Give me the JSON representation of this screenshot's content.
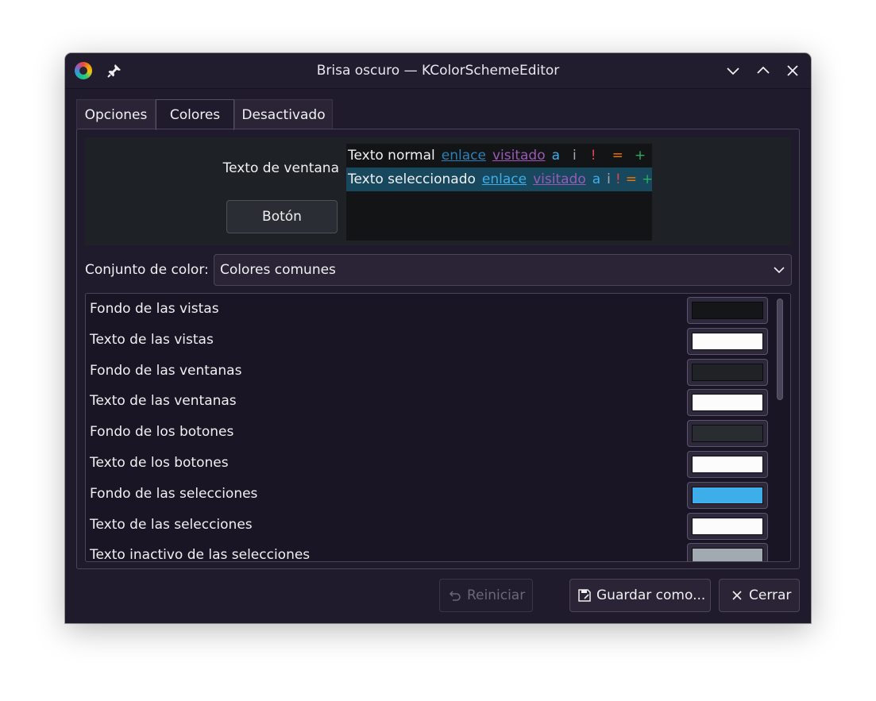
{
  "window": {
    "title": "Brisa oscuro — KColorSchemeEditor"
  },
  "tabs": [
    {
      "label": "Opciones",
      "active": false
    },
    {
      "label": "Colores",
      "active": true
    },
    {
      "label": "Desactivado",
      "active": false
    }
  ],
  "preview": {
    "window_text_label": "Texto de ventana",
    "button_label": "Botón",
    "normal_row": {
      "text": "Texto normal",
      "link": "enlace",
      "visited": "visitado",
      "active": "a",
      "inactive": "i",
      "negative": "!",
      "neutral": "=",
      "positive": "+"
    },
    "selected_row": {
      "text": "Texto seleccionado",
      "link": "enlace",
      "visited": "visitado",
      "active": "a",
      "inactive": "i",
      "negative": "!",
      "neutral": "=",
      "positive": "+"
    }
  },
  "color_set": {
    "label": "Conjunto de color:",
    "value": "Colores comunes"
  },
  "color_roles": [
    {
      "label": "Fondo de las vistas",
      "color": "#141618"
    },
    {
      "label": "Texto de las vistas",
      "color": "#fcfcfc"
    },
    {
      "label": "Fondo de las ventanas",
      "color": "#202326"
    },
    {
      "label": "Texto de las ventanas",
      "color": "#fcfcfc"
    },
    {
      "label": "Fondo de los botones",
      "color": "#292c30"
    },
    {
      "label": "Texto de los botones",
      "color": "#fcfcfc"
    },
    {
      "label": "Fondo de las selecciones",
      "color": "#3daee9"
    },
    {
      "label": "Texto de las selecciones",
      "color": "#fcfcfc"
    },
    {
      "label": "Texto inactivo de las selecciones",
      "color": "#a1a9b1"
    }
  ],
  "buttons": {
    "reset": "Reiniciar",
    "save_as": "Guardar como...",
    "close": "Cerrar"
  }
}
